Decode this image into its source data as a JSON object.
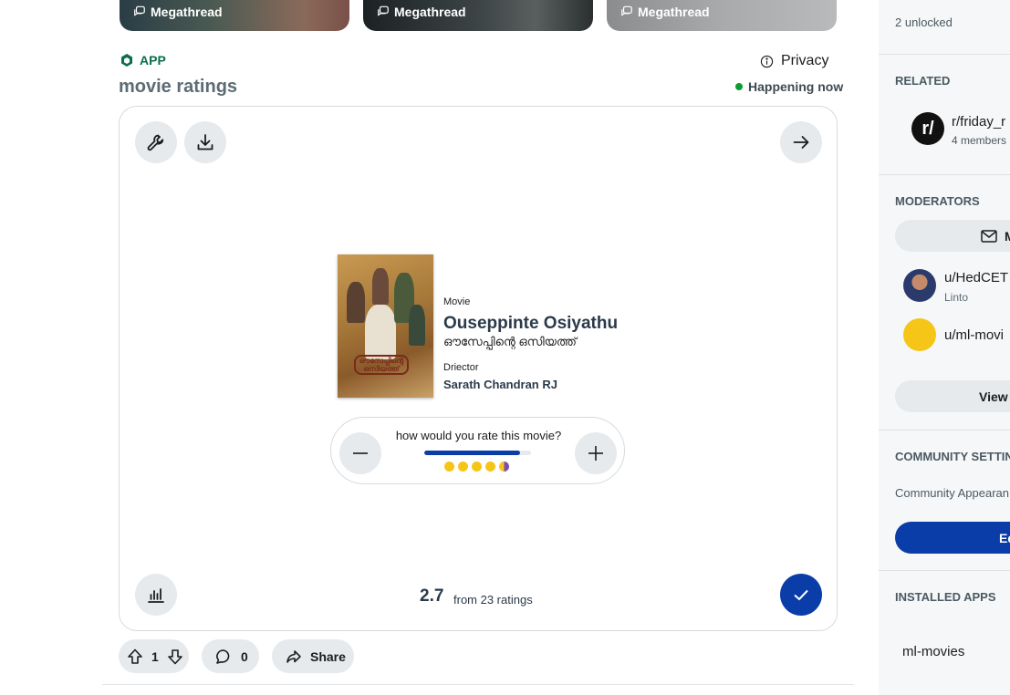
{
  "megathreads": [
    {
      "label": "Megathread"
    },
    {
      "label": "Megathread"
    },
    {
      "label": "Megathread"
    }
  ],
  "app_badge": "APP",
  "privacy_label": "Privacy",
  "post_title": "movie ratings",
  "status": "Happening now",
  "movie": {
    "type_label": "Movie",
    "title": "Ouseppinte Osiyathu",
    "local_title": "ഔസേപ്പിന്റെ ഒസിയത്ത്",
    "director_label": "Driector",
    "director": "Sarath Chandran RJ",
    "poster_text": "ഔസേപ്പിന്റെ ഒസിയത്ത്"
  },
  "rating": {
    "question": "how would you rate this movie?",
    "level_fraction": 0.9,
    "score": "2.7",
    "score_sub": "from 23 ratings",
    "stars": 4.5
  },
  "actions": {
    "upvotes": "1",
    "comments": "0",
    "share": "Share"
  },
  "sidebar": {
    "unlocked": "2 unlocked",
    "related_head": "RELATED",
    "related_name": "r/friday_r",
    "related_members": "4 members",
    "related_icon": "r/",
    "moderators_head": "MODERATORS",
    "message_btn": "M",
    "mods": [
      {
        "name": "u/HedCET",
        "flair": "Linto"
      },
      {
        "name": "u/ml-movi",
        "flair": ""
      }
    ],
    "view_all": "View a",
    "settings_head": "COMMUNITY SETTIN",
    "appearance": "Community Appearan",
    "edit_btn": "Ed",
    "apps_head": "INSTALLED APPS",
    "app_name": "ml-movies"
  },
  "colors": {
    "accent_blue": "#0b3da8",
    "app_green": "#0b6e4f",
    "live_green": "#0a9e34",
    "star_yellow": "#f5c518"
  }
}
